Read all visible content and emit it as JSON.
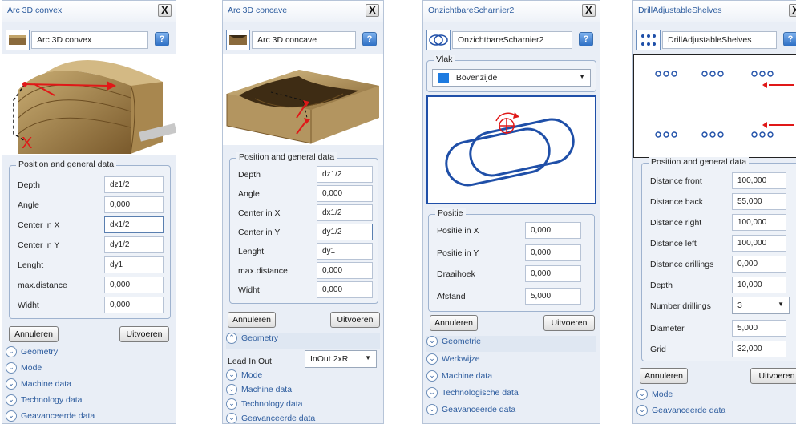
{
  "panels": [
    {
      "title": "Arc 3D convex",
      "close": "X",
      "selector": {
        "name": "Arc 3D convex",
        "thumb_icon": "arc-convex-thumb-icon",
        "help": "?"
      },
      "group_title": "Position and general data",
      "fields": [
        {
          "label": "Depth",
          "value": "dz1/2"
        },
        {
          "label": "Angle",
          "value": "0,000"
        },
        {
          "label": "Center in X",
          "value": "dx1/2"
        },
        {
          "label": "Center in Y",
          "value": "dy1/2"
        },
        {
          "label": "Lenght",
          "value": "dy1"
        },
        {
          "label": "max.distance",
          "value": "0,000"
        },
        {
          "label": "Widht",
          "value": "0,000"
        }
      ],
      "cancel": "Annuleren",
      "execute": "Uitvoeren",
      "sections": [
        "Geometry",
        "Mode",
        "Machine data",
        "Technology data",
        "Geavanceerde data"
      ]
    },
    {
      "title": "Arc 3D concave",
      "close": "X",
      "selector": {
        "name": "Arc 3D concave",
        "thumb_icon": "arc-concave-thumb-icon",
        "help": "?"
      },
      "group_title": "Position and general data",
      "fields": [
        {
          "label": "Depth",
          "value": "dz1/2"
        },
        {
          "label": "Angle",
          "value": "0,000"
        },
        {
          "label": "Center in X",
          "value": "dx1/2"
        },
        {
          "label": "Center in Y",
          "value": "dy1/2"
        },
        {
          "label": "Lenght",
          "value": "dy1"
        },
        {
          "label": "max.distance",
          "value": "0,000"
        },
        {
          "label": "Widht",
          "value": "0,000"
        }
      ],
      "cancel": "Annuleren",
      "execute": "Uitvoeren",
      "geometry": {
        "section": "Geometry",
        "label": "Lead In Out",
        "value": "InOut 2xR"
      },
      "sections": [
        "Mode",
        "Machine data",
        "Technology data",
        "Geavanceerde data"
      ]
    },
    {
      "title": "OnzichtbareScharnier2",
      "close": "X",
      "selector": {
        "name": "OnzichtbareScharnier2",
        "thumb_icon": "hinge-thumb-icon",
        "help": "?"
      },
      "vlak": {
        "title": "Vlak",
        "value": "Bovenzijde",
        "color": "#1e7be0"
      },
      "group_title": "Positie",
      "fields": [
        {
          "label": "Positie in X",
          "value": "0,000"
        },
        {
          "label": "Positie in Y",
          "value": "0,000"
        },
        {
          "label": "Draaihoek",
          "value": "0,000"
        },
        {
          "label": "Afstand",
          "value": "5,000"
        }
      ],
      "cancel": "Annuleren",
      "execute": "Uitvoeren",
      "sections": [
        "Geometrie",
        "Werkwijze",
        "Machine data",
        "Technologische data",
        "Geavanceerde data"
      ]
    },
    {
      "title": "DrillAdjustableShelves",
      "close": "X",
      "selector": {
        "name": "DrillAdjustableShelves",
        "thumb_icon": "drill-grid-thumb-icon",
        "help": "?"
      },
      "group_title": "Position and general data",
      "fields": [
        {
          "label": "Distance front",
          "value": "100,000"
        },
        {
          "label": "Distance back",
          "value": "55,000"
        },
        {
          "label": "Distance right",
          "value": "100,000"
        },
        {
          "label": "Distance left",
          "value": "100,000"
        },
        {
          "label": "Distance drillings",
          "value": "0,000"
        },
        {
          "label": "Depth",
          "value": "10,000"
        },
        {
          "label": "Number drillings",
          "value": "3"
        },
        {
          "label": "Diameter",
          "value": "5,000"
        },
        {
          "label": "Grid",
          "value": "32,000"
        }
      ],
      "cancel": "Annuleren",
      "execute": "Uitvoeren",
      "sections": [
        "Mode",
        "Geavanceerde data"
      ]
    }
  ]
}
